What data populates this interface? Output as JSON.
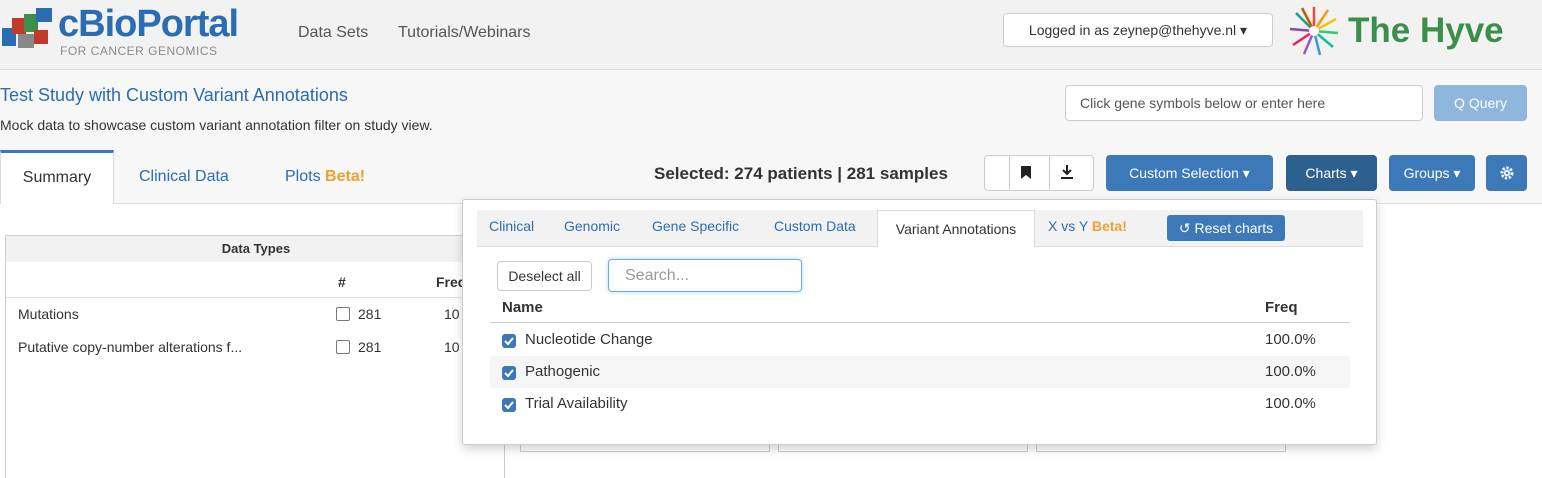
{
  "header": {
    "logo_title": "cBioPortal",
    "logo_subtitle": "FOR CANCER GENOMICS",
    "nav": [
      "Data Sets",
      "Tutorials/Webinars"
    ],
    "login_label": "Logged in as zeynep@thehyve.nl ▾",
    "partner": "The Hyve"
  },
  "study": {
    "title": "Test Study with Custom Variant Annotations",
    "description": "Mock data to showcase custom variant annotation filter on study view.",
    "gene_placeholder": "Click gene symbols below or enter here",
    "query_label": "Q Query"
  },
  "tabs": [
    {
      "label": "Summary"
    },
    {
      "label": "Clinical Data"
    },
    {
      "label": "Plots",
      "badge": "Beta!"
    }
  ],
  "toolbar": {
    "selected": "Selected: 274 patients | 281 samples",
    "custom_selection": "Custom Selection ▾",
    "charts": "Charts ▾",
    "groups": "Groups ▾"
  },
  "data_types": {
    "title": "Data Types",
    "columns": [
      "#",
      "Freq"
    ],
    "rows": [
      {
        "name": "Mutations",
        "count": "281",
        "freq": "10"
      },
      {
        "name": "Putative copy-number alterations f...",
        "count": "281",
        "freq": "10"
      }
    ]
  },
  "charts_menu": {
    "tabs": [
      "Clinical",
      "Genomic",
      "Gene Specific",
      "Custom Data",
      "Variant Annotations",
      "X vs Y"
    ],
    "x_vs_y_badge": "Beta!",
    "reset_label": "↺ Reset charts",
    "active_tab": "Variant Annotations",
    "deselect_label": "Deselect all",
    "search_placeholder": "Search...",
    "columns": [
      "Name",
      "Freq"
    ],
    "rows": [
      {
        "name": "Nucleotide Change",
        "freq": "100.0%",
        "checked": true
      },
      {
        "name": "Pathogenic",
        "freq": "100.0%",
        "checked": true
      },
      {
        "name": "Trial Availability",
        "freq": "100.0%",
        "checked": true
      }
    ]
  },
  "colors": {
    "accent": "#3d79b8",
    "link": "#2a6db2",
    "beta": "#f0a030",
    "partner": "#3b8f4a"
  }
}
